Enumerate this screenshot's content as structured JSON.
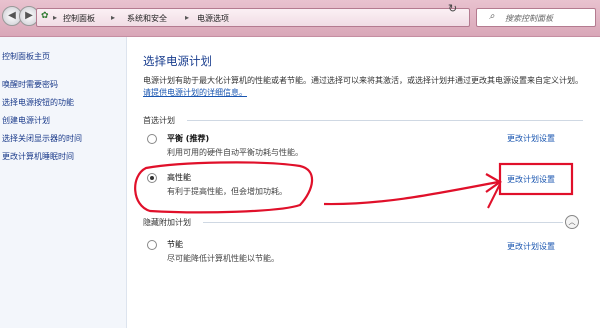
{
  "address_bar": {
    "crumbs": [
      "控制面板",
      "系统和安全",
      "电源选项"
    ],
    "search_placeholder": "搜索控制面板"
  },
  "sidebar": {
    "items": [
      "控制面板主页",
      "唤醒时需要密码",
      "选择电源按钮的功能",
      "创建电源计划",
      "选择关闭显示器的时间",
      "更改计算机睡眠时间"
    ]
  },
  "main": {
    "title": "选择电源计划",
    "description": "电源计划有助于最大化计算机的性能或者节能。通过选择可以来将其激活，或选择计划并通过更改其电源设置来自定义计划。",
    "description_link": "请提供电源计划的详细信息。",
    "preferred_header": "首选计划",
    "hidden_header": "隐藏附加计划",
    "plans": [
      {
        "name": "平衡 (推荐)",
        "desc": "利用可用的硬件自动平衡功耗与性能。",
        "selected": false,
        "link": "更改计划设置"
      },
      {
        "name": "高性能",
        "desc": "有利于提高性能，但会增加功耗。",
        "selected": true,
        "link": "更改计划设置"
      },
      {
        "name": "节能",
        "desc": "尽可能降低计算机性能以节能。",
        "selected": false,
        "link": "更改计划设置"
      }
    ]
  },
  "colors": {
    "annotation": "#e0102a",
    "link": "#1a56b0",
    "title": "#1a3e8f"
  }
}
